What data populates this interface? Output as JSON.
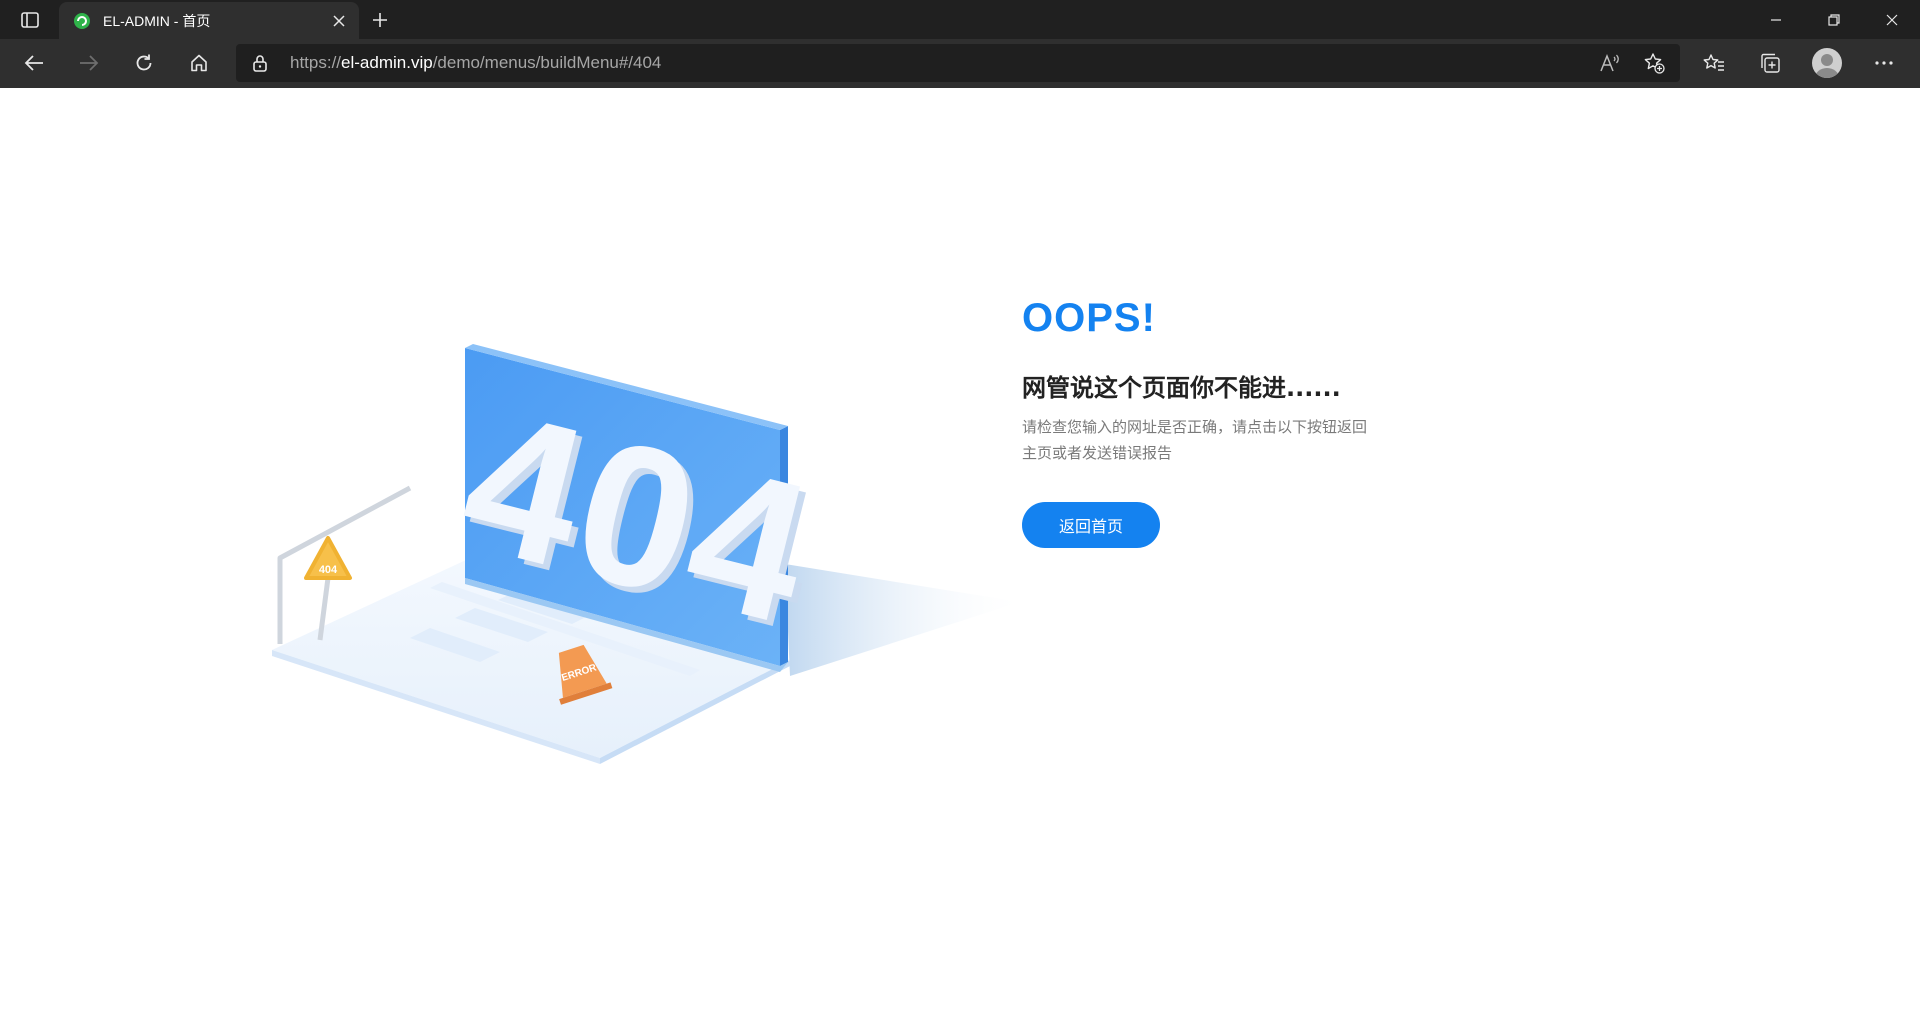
{
  "browser": {
    "tab": {
      "title": "EL-ADMIN - 首页",
      "favicon": "el-admin-logo-icon"
    },
    "address": {
      "scheme": "https://",
      "host": "el-admin.vip",
      "path": "/demo/menus/buildMenu#/404"
    },
    "icons": [
      "tab-actions-icon",
      "close-icon",
      "plus-icon",
      "minimize-icon",
      "restore-icon",
      "window-close-icon",
      "back-arrow-icon",
      "forward-arrow-icon",
      "refresh-icon",
      "home-icon",
      "lock-icon",
      "read-aloud-icon",
      "add-favorite-icon",
      "favorites-icon",
      "collections-icon",
      "profile-icon",
      "more-icon"
    ]
  },
  "page": {
    "title": "OOPS!",
    "headline": "网管说这个页面你不能进......",
    "info_line1": "请检查您输入的网址是否正确，请点击以下按钮返回",
    "info_line2": "主页或者发送错误报告",
    "back_button": "返回首页",
    "illustration": {
      "big_text": "404",
      "sign_text": "404",
      "cone_text": "ERROR"
    }
  },
  "colors": {
    "accent": "#1482f0",
    "titlebar": "#202020",
    "navbar": "#2f2f2f",
    "screen_blue": "#5aa6f5",
    "sign_yellow": "#f7c04a",
    "cone_orange": "#f39a52"
  }
}
